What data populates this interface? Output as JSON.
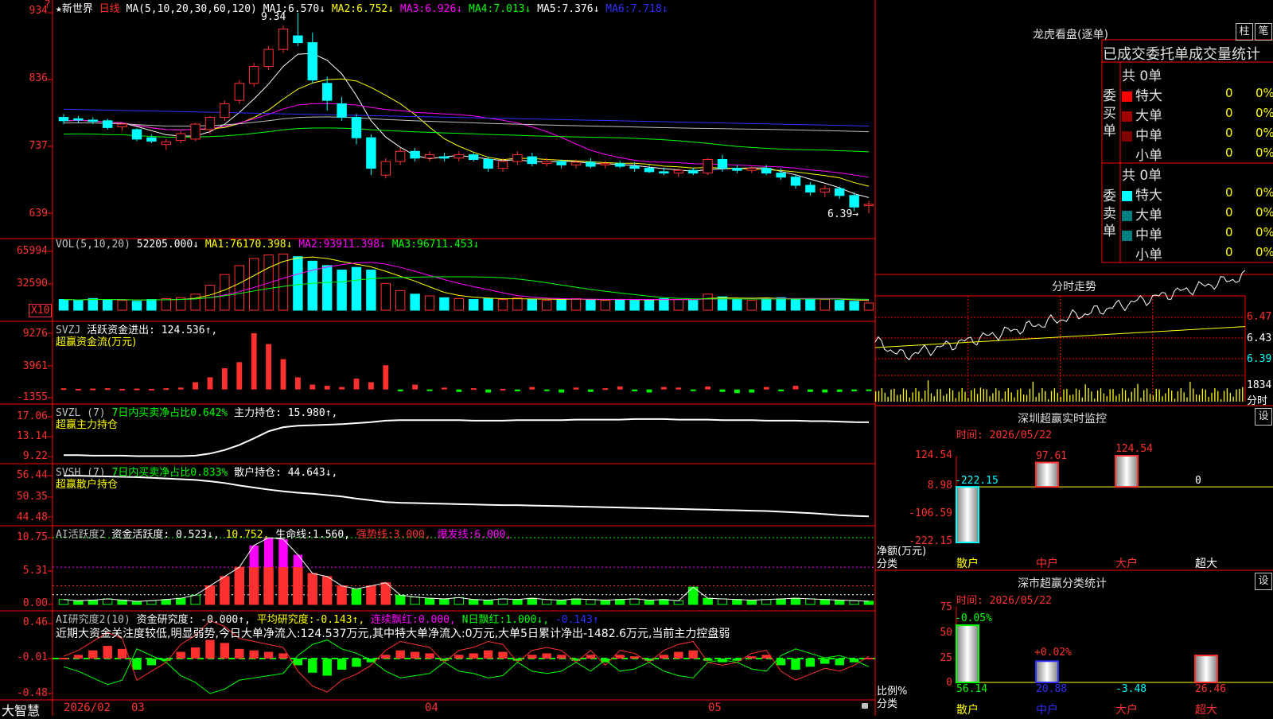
{
  "colors": {
    "up": "#ff3030",
    "down": "#00ffff",
    "ma1": "#ffffff",
    "ma2": "#ffff00",
    "ma3": "#ff00ff",
    "ma4": "#00ff00",
    "ma5": "#c0c0c0",
    "ma6": "#3030ff",
    "grid": "#ff0000"
  },
  "main": {
    "stock_name": "★新世界",
    "period": "日线",
    "ma_params": "MA(5,10,20,30,60,120)",
    "ma": [
      {
        "label": "MA1:",
        "value": "6.570↓"
      },
      {
        "label": "MA2:",
        "value": "6.752↓"
      },
      {
        "label": "MA3:",
        "value": "6.926↓"
      },
      {
        "label": "MA4:",
        "value": "7.013↓"
      },
      {
        "label": "MA5:",
        "value": "7.376↓"
      },
      {
        "label": "MA6:",
        "value": "7.718↓"
      }
    ],
    "y_labels": [
      "934",
      "836",
      "737",
      "639"
    ],
    "high_note": "9.34",
    "low_note": "6.39→"
  },
  "vol": {
    "params": "VOL(5,10,20)",
    "value": "52205.000↓",
    "ma": [
      {
        "label": "MA1:",
        "value": "76170.398↓"
      },
      {
        "label": "MA2:",
        "value": "93911.398↓"
      },
      {
        "label": "MA3:",
        "value": "96711.453↓"
      }
    ],
    "y_labels": [
      "65994",
      "32590"
    ],
    "unit": "X10"
  },
  "svzj": {
    "name": "SVZJ",
    "label": "活跃资金进出:",
    "value": "124.536↑,",
    "sub": "超赢资金流(万元)",
    "y_labels": [
      "9276",
      "3961",
      "-1355"
    ]
  },
  "svzl": {
    "name": "SVZL (7)",
    "ratio": "7日内买卖净占比0.642%",
    "label": "主力持仓:",
    "value": "15.980↑,",
    "sub": "超赢主力持仓",
    "y_labels": [
      "17.06",
      "13.14",
      "9.22"
    ]
  },
  "svsh": {
    "name": "SVSH (7)",
    "ratio": "7日内买卖净占比0.833%",
    "label": "散户持仓:",
    "value": "44.643↓,",
    "sub": "超赢散户持仓",
    "y_labels": [
      "56.44",
      "50.35",
      "44.48"
    ]
  },
  "ai1": {
    "name": "AI活跃度2",
    "label": "资金活跃度:",
    "value": "0.523↓,",
    "v2": "10.752,",
    "l3": "生命线:",
    "v3": "1.560,",
    "l4": "强势线:",
    "v4": "3.000,",
    "l5": "爆发线:",
    "v5": "6.000,",
    "y_labels": [
      "10.75",
      "5.31",
      "0.00"
    ]
  },
  "ai2": {
    "name": "AI研究度2(10)",
    "label": "资金研究度:",
    "value": "-0.000↑,",
    "l2": "平均研究度:",
    "v2": "-0.143↑,",
    "l3": "连续飘红:",
    "v3": "0.000,",
    "l4": "N日飘红:",
    "v4": "1.000↓,",
    "v5": "-0.143↑",
    "comment": "近期大资金关注度较低,明显弱势,今日大单净流入:124.537万元,其中特大单净流入:0万元,大单5日累计净出-1482.6万元,当前主力控盘弱",
    "y_labels": [
      "0.46",
      "-0.01",
      "-0.48"
    ]
  },
  "bottom": {
    "logo": "大智慧",
    "dates": [
      "2026/02",
      "03",
      "04",
      "05"
    ]
  },
  "right": {
    "lhb_title": "龙虎看盘(逐单)",
    "btn_bar": "柱",
    "btn_pen": "笔",
    "stat_title": "已成交委托单成交量统计",
    "buy": {
      "side": "委买单",
      "total": "共 0单",
      "rows": [
        {
          "label": "特大",
          "n": "0",
          "p": "0%",
          "color": "#ff0000"
        },
        {
          "label": "大单",
          "n": "0",
          "p": "0%",
          "color": "#a00000"
        },
        {
          "label": "中单",
          "n": "0",
          "p": "0%",
          "color": "#800000"
        },
        {
          "label": "小单",
          "n": "0",
          "p": "0%",
          "color": ""
        }
      ]
    },
    "sell": {
      "side": "委卖单",
      "total": "共 0单",
      "rows": [
        {
          "label": "特大",
          "n": "0",
          "p": "0%",
          "color": "#00ffff"
        },
        {
          "label": "大单",
          "n": "0",
          "p": "0%",
          "color": "#008080"
        },
        {
          "label": "中单",
          "n": "0",
          "p": "0%",
          "color": "#008080"
        },
        {
          "label": "小单",
          "n": "0",
          "p": "0%",
          "color": ""
        }
      ]
    },
    "fs_title": "分时走势",
    "fs_y": [
      "6.47",
      "6.43",
      "6.39",
      "1834",
      "分时"
    ],
    "mon_title": "深圳超赢实时监控",
    "mon_date": "时间: 2026/05/22",
    "mon_btn": "设",
    "mon_y": [
      "124.54",
      "8.98",
      "-106.59",
      "-222.15"
    ],
    "mon_ylabel": "净额(万元)",
    "mon_xlabel": "分类",
    "mon_cats": [
      "散户",
      "中户",
      "大户",
      "超大"
    ],
    "mon_vals": [
      "-222.15",
      "97.61",
      "124.54",
      "0"
    ],
    "cls_title": "深市超赢分类统计",
    "cls_date": "时间: 2026/05/22",
    "cls_btn": "设",
    "cls_y": [
      "75",
      "50",
      "25",
      "0"
    ],
    "cls_ylabel": "比例%",
    "cls_xlabel": "分类",
    "cls_top": [
      "-0.05%",
      "+0.02%"
    ],
    "cls_cats": [
      "散户",
      "中户",
      "大户",
      "超大"
    ],
    "cls_vals": [
      "56.14",
      "20.88",
      "-3.48",
      "26.46"
    ]
  },
  "chart_data": {
    "type": "candlestick",
    "title": "新世界 日线",
    "ylim": [
      6.39,
      9.34
    ],
    "x_ticks": [
      "2026/02",
      "03",
      "04",
      "05"
    ],
    "ohlc": [
      [
        7.8,
        7.85,
        7.7,
        7.75
      ],
      [
        7.78,
        7.82,
        7.72,
        7.76
      ],
      [
        7.76,
        7.8,
        7.7,
        7.74
      ],
      [
        7.75,
        7.78,
        7.62,
        7.65
      ],
      [
        7.66,
        7.72,
        7.6,
        7.7
      ],
      [
        7.62,
        7.64,
        7.45,
        7.48
      ],
      [
        7.5,
        7.55,
        7.42,
        7.45
      ],
      [
        7.4,
        7.48,
        7.32,
        7.44
      ],
      [
        7.46,
        7.6,
        7.42,
        7.56
      ],
      [
        7.48,
        7.72,
        7.45,
        7.7
      ],
      [
        7.62,
        7.82,
        7.55,
        7.8
      ],
      [
        7.8,
        8.05,
        7.75,
        8.0
      ],
      [
        8.05,
        8.35,
        8.0,
        8.3
      ],
      [
        8.3,
        8.6,
        8.25,
        8.55
      ],
      [
        8.55,
        8.85,
        8.5,
        8.8
      ],
      [
        8.8,
        9.15,
        8.75,
        9.1
      ],
      [
        9.0,
        9.34,
        8.85,
        8.9
      ],
      [
        8.9,
        9.05,
        8.3,
        8.35
      ],
      [
        8.3,
        8.4,
        7.9,
        8.05
      ],
      [
        8.0,
        8.1,
        7.75,
        7.8
      ],
      [
        7.8,
        7.85,
        7.4,
        7.5
      ],
      [
        7.5,
        7.55,
        6.95,
        7.05
      ],
      [
        6.95,
        7.2,
        6.9,
        7.15
      ],
      [
        7.15,
        7.35,
        7.1,
        7.3
      ],
      [
        7.3,
        7.35,
        7.15,
        7.2
      ],
      [
        7.2,
        7.3,
        7.15,
        7.25
      ],
      [
        7.22,
        7.28,
        7.15,
        7.2
      ],
      [
        7.2,
        7.3,
        7.15,
        7.25
      ],
      [
        7.25,
        7.28,
        7.15,
        7.18
      ],
      [
        7.18,
        7.22,
        7.0,
        7.05
      ],
      [
        7.05,
        7.2,
        7.0,
        7.15
      ],
      [
        7.15,
        7.3,
        7.1,
        7.25
      ],
      [
        7.22,
        7.28,
        7.08,
        7.12
      ],
      [
        7.12,
        7.2,
        7.08,
        7.15
      ],
      [
        7.15,
        7.18,
        7.05,
        7.1
      ],
      [
        7.1,
        7.18,
        7.05,
        7.14
      ],
      [
        7.14,
        7.2,
        7.05,
        7.08
      ],
      [
        7.1,
        7.16,
        7.05,
        7.12
      ],
      [
        7.12,
        7.16,
        7.05,
        7.08
      ],
      [
        7.08,
        7.14,
        7.0,
        7.05
      ],
      [
        7.05,
        7.1,
        6.98,
        7.0
      ],
      [
        7.0,
        7.06,
        6.95,
        6.98
      ],
      [
        6.98,
        7.05,
        6.92,
        7.02
      ],
      [
        7.02,
        7.06,
        6.95,
        6.98
      ],
      [
        6.98,
        7.2,
        6.95,
        7.18
      ],
      [
        7.18,
        7.25,
        7.0,
        7.05
      ],
      [
        7.05,
        7.1,
        6.98,
        7.02
      ],
      [
        7.02,
        7.08,
        6.98,
        7.05
      ],
      [
        7.05,
        7.1,
        6.95,
        6.98
      ],
      [
        6.98,
        7.05,
        6.88,
        6.92
      ],
      [
        6.92,
        6.95,
        6.75,
        6.8
      ],
      [
        6.8,
        6.85,
        6.65,
        6.7
      ],
      [
        6.7,
        6.8,
        6.62,
        6.75
      ],
      [
        6.75,
        6.78,
        6.6,
        6.65
      ],
      [
        6.65,
        6.7,
        6.42,
        6.48
      ],
      [
        6.5,
        6.57,
        6.39,
        6.52
      ]
    ],
    "volume": [
      12,
      11,
      13,
      12,
      11,
      10,
      12,
      13,
      14,
      18,
      28,
      40,
      50,
      58,
      62,
      63,
      60,
      55,
      50,
      45,
      48,
      45,
      30,
      22,
      18,
      16,
      14,
      13,
      12,
      13,
      12,
      14,
      12,
      11,
      12,
      13,
      12,
      11,
      12,
      11,
      12,
      13,
      12,
      11,
      18,
      15,
      12,
      11,
      13,
      14,
      12,
      13,
      12,
      11,
      10,
      8
    ],
    "svzj": [
      200,
      100,
      150,
      200,
      100,
      150,
      100,
      200,
      300,
      1200,
      2000,
      3500,
      4500,
      9276,
      7500,
      5000,
      2000,
      800,
      600,
      400,
      1800,
      1200,
      4000,
      -300,
      800,
      -200,
      300,
      -400,
      200,
      -500,
      100,
      -300,
      400,
      -200,
      -500,
      300,
      -400,
      200,
      500,
      -300,
      -500,
      400,
      300,
      -200,
      500,
      -400,
      -600,
      -500,
      400,
      -300,
      600,
      -400,
      -500,
      -400,
      -300,
      -200
    ],
    "svzl": [
      9.5,
      9.5,
      9.4,
      9.4,
      9.4,
      9.3,
      9.3,
      9.3,
      9.3,
      9.4,
      9.8,
      10.5,
      11.5,
      12.8,
      14.2,
      15.0,
      15.3,
      15.4,
      15.5,
      15.6,
      15.8,
      16.0,
      16.3,
      16.4,
      16.4,
      16.4,
      16.4,
      16.4,
      16.3,
      16.3,
      16.3,
      16.4,
      16.4,
      16.4,
      16.4,
      16.5,
      16.5,
      16.5,
      16.5,
      16.6,
      16.6,
      16.6,
      16.5,
      16.5,
      16.5,
      16.4,
      16.4,
      16.4,
      16.3,
      16.3,
      16.3,
      16.2,
      16.2,
      16.1,
      16.0,
      15.98
    ],
    "svsh": [
      56.4,
      56.4,
      56.3,
      56.2,
      56.1,
      56.0,
      55.8,
      55.6,
      55.4,
      55.2,
      54.8,
      54.3,
      53.6,
      53.0,
      52.4,
      51.9,
      51.5,
      51.2,
      50.8,
      50.4,
      49.8,
      49.3,
      48.8,
      48.6,
      48.5,
      48.4,
      48.3,
      48.2,
      48.1,
      48.0,
      47.9,
      47.9,
      47.8,
      47.7,
      47.6,
      47.5,
      47.4,
      47.3,
      47.2,
      47.1,
      47.0,
      46.9,
      46.8,
      46.7,
      46.6,
      46.5,
      46.4,
      46.3,
      46.2,
      46.0,
      45.8,
      45.6,
      45.3,
      45.0,
      44.8,
      44.64
    ],
    "ai_active": [
      0.8,
      0.6,
      0.7,
      0.9,
      0.7,
      0.5,
      0.6,
      0.8,
      1.0,
      1.5,
      3.0,
      4.5,
      6.0,
      9.5,
      10.75,
      10.5,
      8.0,
      5.0,
      4.5,
      3.0,
      2.5,
      3.0,
      3.5,
      1.5,
      1.2,
      1.0,
      0.9,
      1.1,
      0.8,
      0.7,
      0.9,
      0.8,
      1.0,
      0.8,
      0.7,
      0.9,
      0.8,
      0.7,
      0.8,
      0.9,
      0.7,
      0.8,
      0.6,
      2.8,
      1.0,
      0.9,
      0.8,
      0.7,
      0.8,
      0.9,
      1.0,
      0.9,
      0.8,
      0.7,
      0.6,
      0.523
    ],
    "ai_research": [
      0.0,
      0.02,
      0.05,
      0.08,
      0.06,
      -0.08,
      -0.05,
      -0.02,
      0.04,
      0.07,
      0.12,
      0.1,
      0.06,
      0.05,
      0.04,
      0.03,
      -0.05,
      -0.1,
      -0.12,
      -0.08,
      -0.06,
      -0.03,
      0.02,
      0.05,
      0.04,
      0.03,
      -0.02,
      0.02,
      0.03,
      0.05,
      0.04,
      -0.02,
      0.02,
      0.03,
      0.02,
      -0.02,
      0.02,
      -0.03,
      0.02,
      0.01,
      -0.02,
      0.02,
      0.04,
      0.05,
      -0.02,
      -0.03,
      -0.02,
      0.01,
      0.02,
      -0.05,
      -0.08,
      -0.06,
      -0.04,
      -0.05,
      -0.03,
      0.0
    ]
  }
}
